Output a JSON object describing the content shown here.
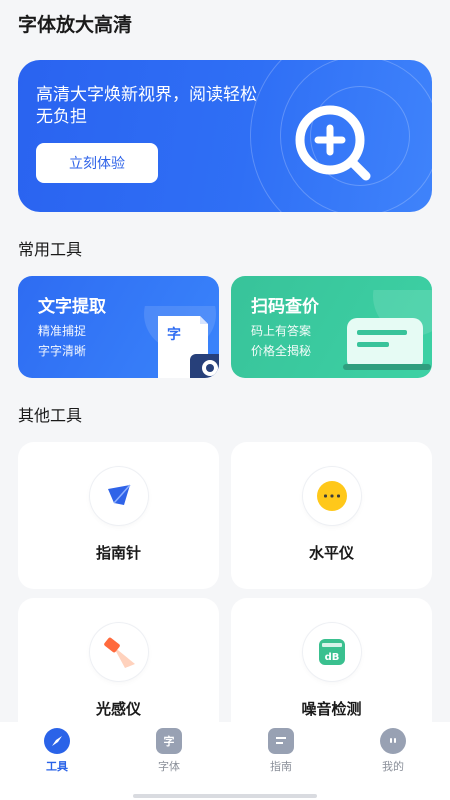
{
  "header": {
    "title": "字体放大高清"
  },
  "hero": {
    "title": "高清大字焕新视界，阅读轻松无负担",
    "button_label": "立刻体验",
    "accent": "#2f6ff5"
  },
  "common_tools": {
    "section_title": "常用工具",
    "cards": [
      {
        "title": "文字提取",
        "lines": [
          "精准捕捉",
          "字字清晰"
        ],
        "icon_text": "字",
        "color": "#2e6cf2"
      },
      {
        "title": "扫码查价",
        "lines": [
          "码上有答案",
          "价格全揭秘"
        ],
        "color": "#38c39a"
      }
    ]
  },
  "other_tools": {
    "section_title": "其他工具",
    "items": [
      {
        "label": "指南针",
        "icon": "compass-icon"
      },
      {
        "label": "水平仪",
        "icon": "level-icon"
      },
      {
        "label": "光感仪",
        "icon": "light-sensor-icon"
      },
      {
        "label": "噪音检测",
        "icon": "noise-meter-icon",
        "icon_text": "dB"
      }
    ]
  },
  "bottom_nav": {
    "items": [
      {
        "label": "工具",
        "active": true
      },
      {
        "label": "字体",
        "icon_text": "字"
      },
      {
        "label": "指南"
      },
      {
        "label": "我的"
      }
    ]
  }
}
